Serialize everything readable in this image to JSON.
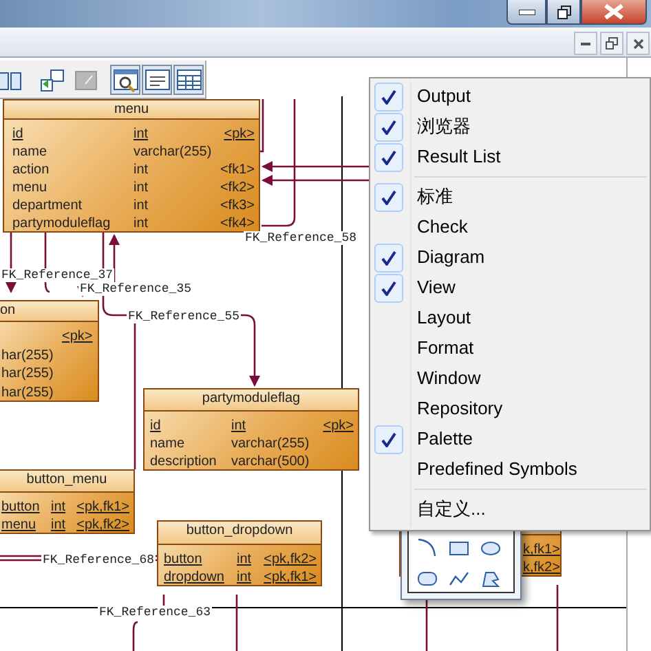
{
  "diagram": {
    "tables": [
      {
        "name": "menu",
        "columns": [
          {
            "name": "id",
            "type": "int",
            "key": "<pk>",
            "primary": true
          },
          {
            "name": "name",
            "type": "varchar(255)",
            "primary": false
          },
          {
            "name": "action",
            "type": "int",
            "key": "<fk1>",
            "primary": false
          },
          {
            "name": "menu",
            "type": "int",
            "key": "<fk2>",
            "primary": false
          },
          {
            "name": "department",
            "type": "int",
            "key": "<fk3>",
            "primary": false
          },
          {
            "name": "partymoduleflag",
            "type": "int",
            "key": "<fk4>",
            "primary": false
          }
        ]
      },
      {
        "name": "on",
        "columns": [
          {
            "key": "<pk>",
            "primary": true
          },
          {
            "type": "har(255)",
            "primary": false
          },
          {
            "type": "har(255)",
            "primary": false
          },
          {
            "type": "har(255)",
            "primary": false
          }
        ]
      },
      {
        "name": "partymoduleflag",
        "columns": [
          {
            "name": "id",
            "type": "int",
            "key": "<pk>",
            "primary": true
          },
          {
            "name": "name",
            "type": "varchar(255)",
            "primary": false
          },
          {
            "name": "description",
            "type": "varchar(500)",
            "primary": false
          }
        ]
      },
      {
        "name": "button_menu",
        "columns": [
          {
            "name": "button",
            "type": "int",
            "key": "<pk,fk1>",
            "primary": true
          },
          {
            "name": "menu",
            "type": "int",
            "key": "<pk,fk2>",
            "primary": true
          }
        ]
      },
      {
        "name": "button_dropdown",
        "columns": [
          {
            "name": "button",
            "type": "int",
            "key": "<pk,fk2>",
            "primary": true
          },
          {
            "name": "dropdown",
            "type": "int",
            "key": "<pk,fk1>",
            "primary": true
          }
        ]
      },
      {
        "columns": [
          {
            "key": "k,fk1>",
            "primary": true
          },
          {
            "key": "k,fk2>",
            "primary": true
          }
        ]
      }
    ],
    "references": [
      {
        "label": "FK_Reference_58"
      },
      {
        "label": "FK_Reference_37"
      },
      {
        "label": "FK_Reference_35"
      },
      {
        "label": "FK_Reference_55"
      },
      {
        "label": "FK_Reference_68"
      },
      {
        "label": "FK_Reference_63"
      }
    ]
  },
  "context_menu": {
    "items": [
      {
        "kind": "toggle",
        "label": "Output",
        "checked": true
      },
      {
        "kind": "toggle",
        "label": "浏览器",
        "checked": true
      },
      {
        "kind": "toggle",
        "label": "Result List",
        "checked": true
      },
      {
        "kind": "separator"
      },
      {
        "kind": "toggle",
        "label": "标准",
        "checked": true
      },
      {
        "kind": "toggle",
        "label": "Check",
        "checked": false
      },
      {
        "kind": "toggle",
        "label": "Diagram",
        "checked": true
      },
      {
        "kind": "toggle",
        "label": "View",
        "checked": true
      },
      {
        "kind": "toggle",
        "label": "Layout",
        "checked": false
      },
      {
        "kind": "toggle",
        "label": "Format",
        "checked": false
      },
      {
        "kind": "toggle",
        "label": "Window",
        "checked": false
      },
      {
        "kind": "toggle",
        "label": "Repository",
        "checked": false
      },
      {
        "kind": "toggle",
        "label": "Palette",
        "checked": true
      },
      {
        "kind": "toggle",
        "label": "Predefined Symbols",
        "checked": false
      },
      {
        "kind": "separator"
      },
      {
        "kind": "toggle",
        "label": "自定义...",
        "checked": false
      }
    ]
  }
}
